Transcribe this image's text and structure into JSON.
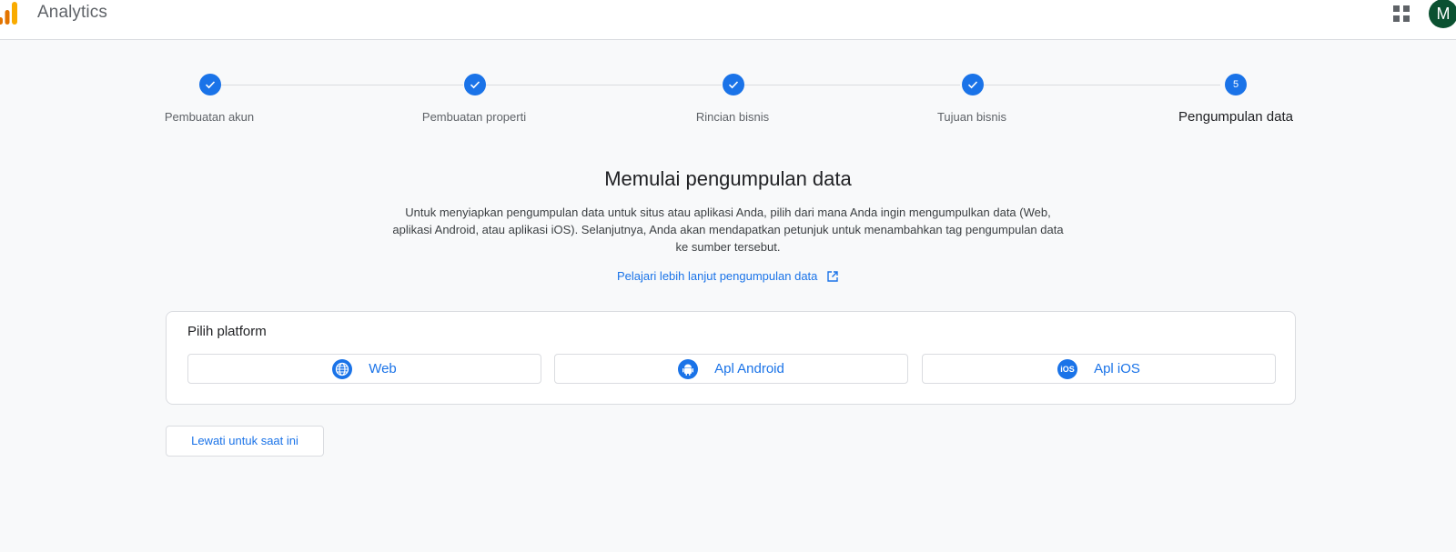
{
  "app": {
    "title": "Analytics",
    "avatar_initial": "M",
    "brand_color": "#f9ab00",
    "accent": "#1a73e8"
  },
  "stepper": {
    "steps": [
      {
        "label": "Pembuatan akun",
        "state": "done"
      },
      {
        "label": "Pembuatan properti",
        "state": "done"
      },
      {
        "label": "Rincian bisnis",
        "state": "done"
      },
      {
        "label": "Tujuan bisnis",
        "state": "done"
      },
      {
        "label": "Pengumpulan data",
        "state": "active",
        "number": "5"
      }
    ]
  },
  "intro": {
    "title": "Memulai pengumpulan data",
    "description": "Untuk menyiapkan pengumpulan data untuk situs atau aplikasi Anda, pilih dari mana Anda ingin mengumpulkan data (Web, aplikasi Android, atau aplikasi iOS). Selanjutnya, Anda akan mendapatkan petunjuk untuk menambahkan tag pengumpulan data ke sumber tersebut.",
    "link": "Pelajari lebih lanjut pengumpulan data"
  },
  "platform": {
    "title": "Pilih platform",
    "options": [
      {
        "label": "Web",
        "icon": "globe-icon"
      },
      {
        "label": "Apl Android",
        "icon": "android-icon"
      },
      {
        "label": "Apl iOS",
        "icon": "ios-icon",
        "icon_text": "iOS"
      }
    ]
  },
  "skip_button": "Lewati untuk saat ini"
}
